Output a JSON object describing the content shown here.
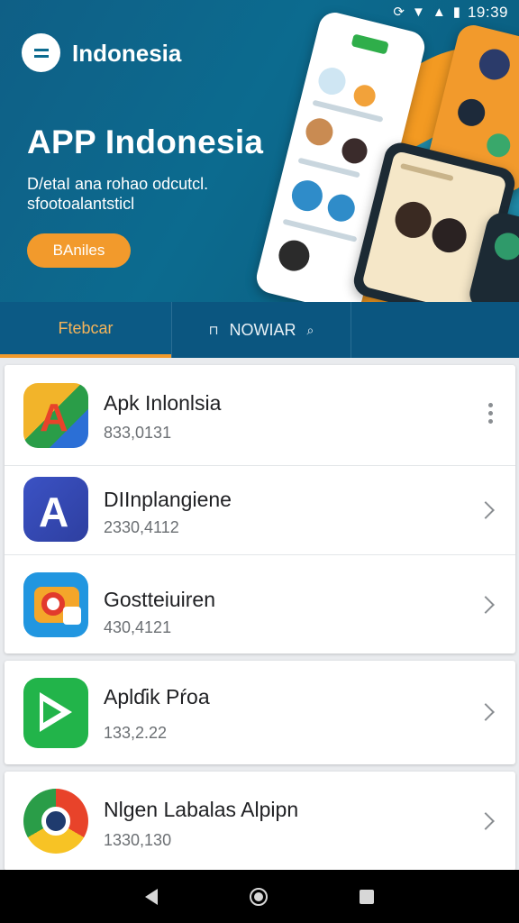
{
  "status_bar": {
    "icons": [
      "sync-icon",
      "wifi-icon",
      "signal-icon",
      "battery-icon"
    ],
    "time": "19:39"
  },
  "header": {
    "title": "Indonesia"
  },
  "hero": {
    "title": "APP Indonesia",
    "subtitle": "D/etaI ana rohao odcutcl. sfootoalantsticl",
    "button_label": "BAniles",
    "colors": {
      "bg": "#0c6b8f",
      "accent": "#f29a2c"
    }
  },
  "tabs": [
    {
      "label": "Ftebcar",
      "active": true
    },
    {
      "label": "NOWIAR",
      "active": false
    }
  ],
  "apps": [
    {
      "name": "Apk Inlonlsia",
      "meta": "833,0131",
      "action": "more"
    },
    {
      "name": "DIInplangiene",
      "meta": "2330,4112",
      "action": "chevron"
    },
    {
      "name": "Gostteiuiren",
      "meta": "430,4121",
      "action": "chevron"
    },
    {
      "name": "Aplɗik Pŕoa",
      "meta": "133,2.22",
      "action": "chevron"
    },
    {
      "name": "Nlgen Labalas Alpipn",
      "meta": "1330,130",
      "action": "chevron"
    }
  ]
}
